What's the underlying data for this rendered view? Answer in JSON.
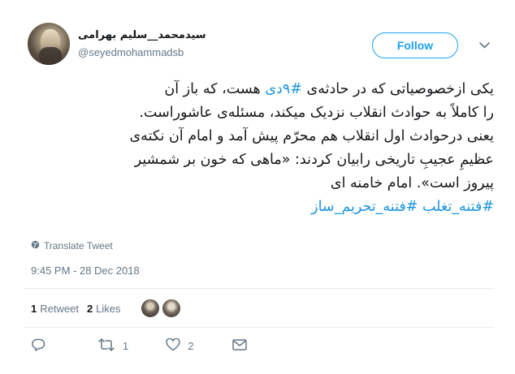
{
  "author": {
    "display_name": "سیدمحمد__سلیم بهرامی",
    "handle": "@seyedmohammadsb"
  },
  "follow_button": {
    "label": "Follow"
  },
  "tweet": {
    "lines": [
      {
        "before": "یکی ازخصوصیاتی که در حادثه‌ی ",
        "hashtag": "#۹دی",
        "after": "  هست، که باز آن"
      },
      {
        "text": "را کاملاً به حوادث انقلاب نزدیک میکند، مسئله‌ی عاشوراست."
      },
      {
        "text": "یعنی درحوادث اول انقلاب هم محرّم پیش آمد و امام آن نکته‌ی"
      },
      {
        "text": "عظیمِ عجیبِ تاریخی رابیان کردند: «ماهی که خون بر شمشیر"
      },
      {
        "text": "پیروز است». امام خامنه ای"
      }
    ],
    "hashtags_line": [
      "#فتنه_تغلب",
      "#فتنه_تحریم_ساز"
    ]
  },
  "translate_label": "Translate Tweet",
  "timestamp": "9:45 PM - 28 Dec 2018",
  "stats": {
    "retweets_count": "1",
    "retweets_label": "Retweet",
    "likes_count": "2",
    "likes_label": "Likes"
  },
  "actions": {
    "retweet_count": "1",
    "like_count": "2"
  },
  "colors": {
    "accent": "#1da1f2",
    "hashtag": "#1b95e0",
    "muted": "#657786",
    "text": "#14171a"
  },
  "icons": [
    "chevron-down-icon",
    "globe-icon",
    "reply-icon",
    "retweet-icon",
    "heart-icon",
    "message-icon"
  ]
}
